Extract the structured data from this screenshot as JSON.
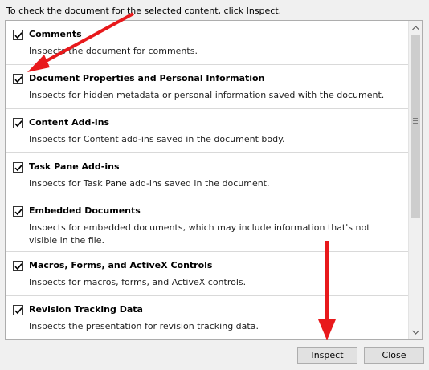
{
  "instruction": "To check the document for the selected content, click Inspect.",
  "items": [
    {
      "title": "Comments",
      "desc": "Inspects the document for comments.",
      "checked": true
    },
    {
      "title": "Document Properties and Personal Information",
      "desc": "Inspects for hidden metadata or personal information saved with the document.",
      "checked": true
    },
    {
      "title": "Content Add-ins",
      "desc": "Inspects for Content add-ins saved in the document body.",
      "checked": true
    },
    {
      "title": "Task Pane Add-ins",
      "desc": "Inspects for Task Pane add-ins saved in the document.",
      "checked": true
    },
    {
      "title": "Embedded Documents",
      "desc": "Inspects for embedded documents, which may include information that's not visible in the file.",
      "checked": true
    },
    {
      "title": "Macros, Forms, and ActiveX Controls",
      "desc": "Inspects for macros, forms, and ActiveX controls.",
      "checked": true
    },
    {
      "title": "Revision Tracking Data",
      "desc": "Inspects the presentation for revision tracking data.",
      "checked": true
    }
  ],
  "buttons": {
    "inspect": "Inspect",
    "close": "Close"
  },
  "colors": {
    "arrow": "#e8191c",
    "check": "#000000"
  },
  "icons": {
    "scroll_up": "scroll-up-icon",
    "scroll_down": "scroll-down-icon",
    "annotation": "arrow-annotation"
  }
}
